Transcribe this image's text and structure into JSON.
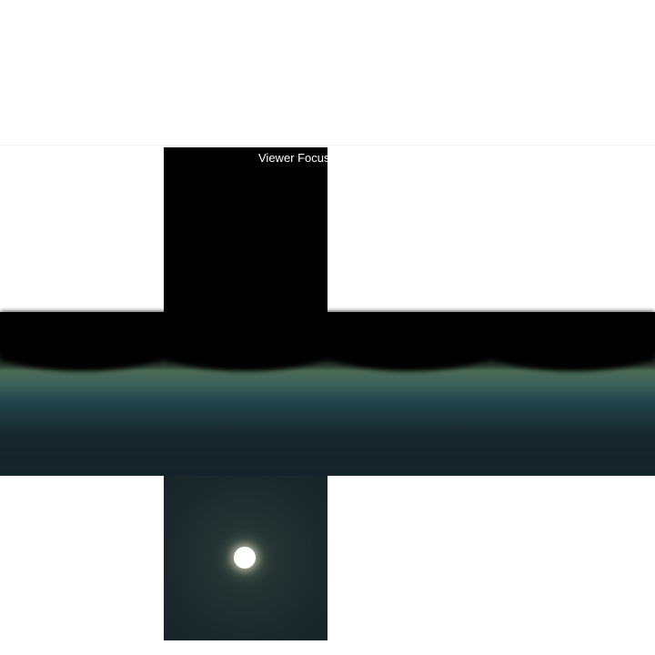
{
  "viewer": {
    "label": "Viewer Focus (C) (TC)"
  },
  "scene": {
    "face_layout": "horizontal-cross",
    "faces": [
      "top",
      "left",
      "front",
      "right",
      "back",
      "bottom"
    ],
    "sky_color_top": "#000000",
    "horizon_glow_color": "#4c6b58",
    "band_color": "#1e3a3e",
    "ground_color": "#1c2a2c",
    "sun_color": "#ffffff"
  }
}
